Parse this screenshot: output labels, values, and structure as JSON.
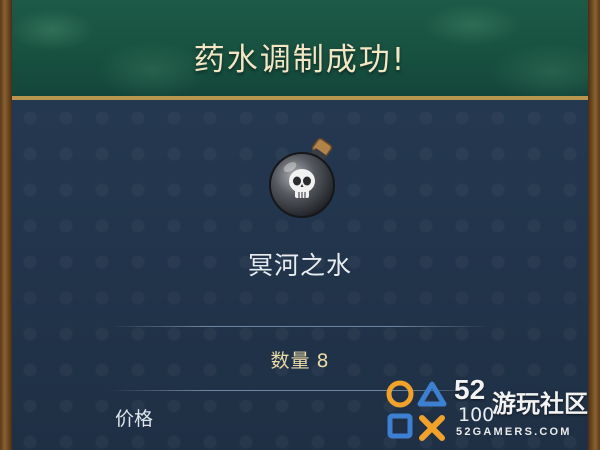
{
  "header": {
    "title": "药水调制成功!"
  },
  "item": {
    "name": "冥河之水",
    "icon": "skull-potion-icon"
  },
  "quantity": {
    "label": "数量",
    "value": "8"
  },
  "price": {
    "label": "价格",
    "value": "100"
  },
  "watermark": {
    "number": "52",
    "name": "游玩社区",
    "domain": "52GAMERS.COM"
  },
  "colors": {
    "header_bg": "#17503f",
    "panel_bg": "#22344a",
    "title_text": "#f3e6c4",
    "quantity_text": "#e8d9a6",
    "logo_orange": "#f0a22a",
    "logo_blue": "#3d7fd0"
  }
}
